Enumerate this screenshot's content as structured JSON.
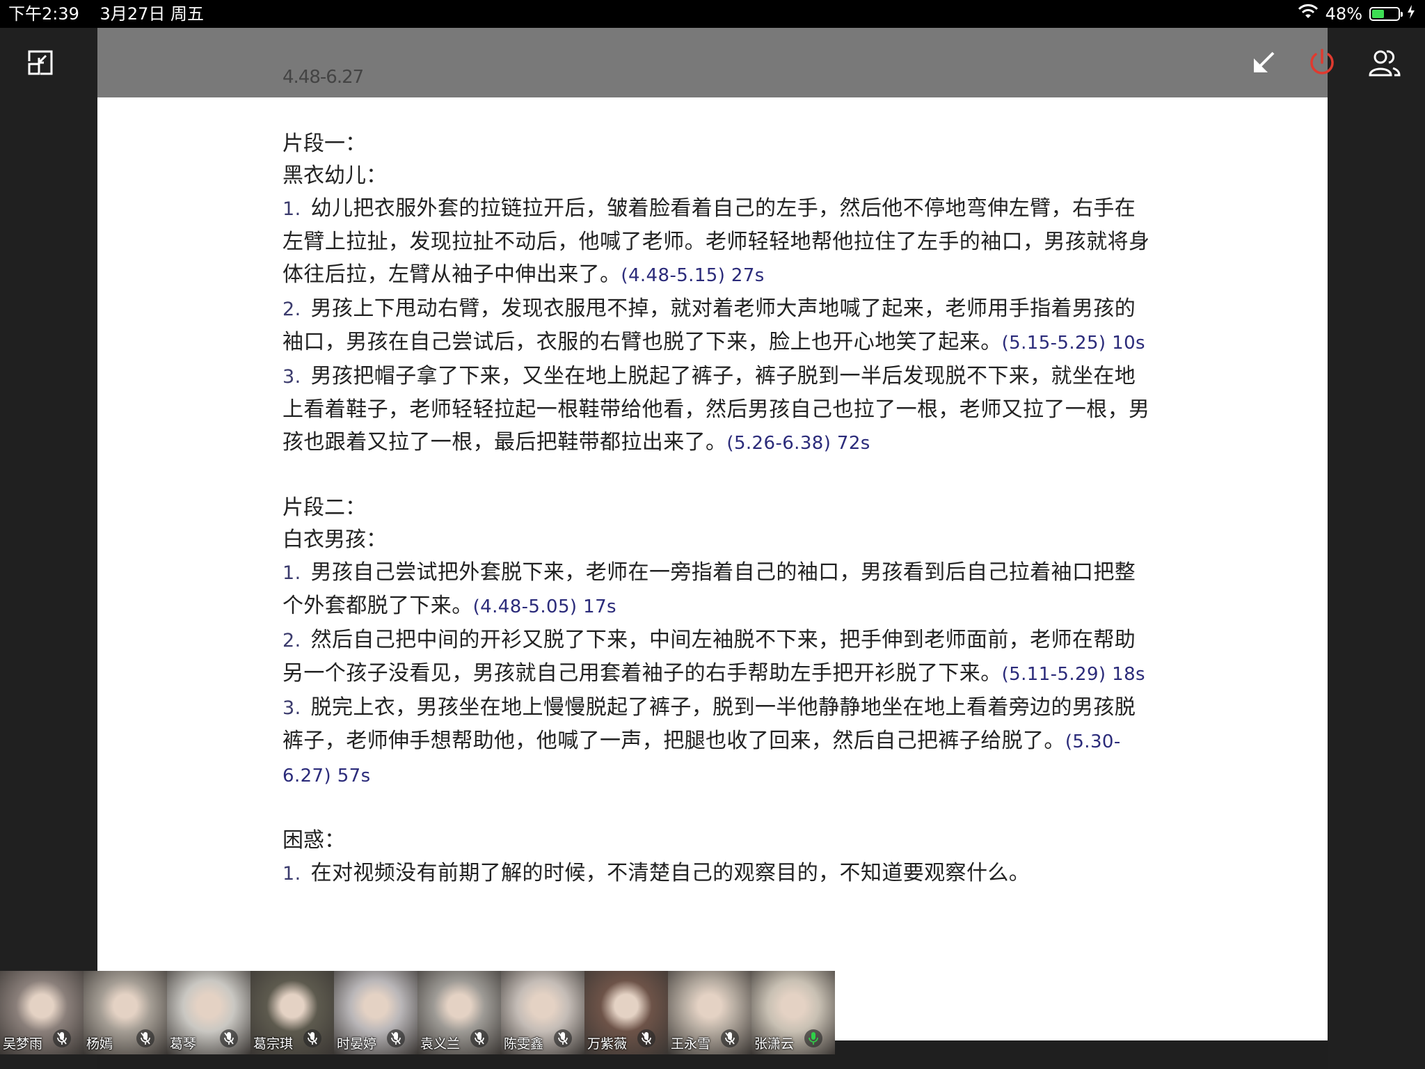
{
  "status_bar": {
    "time": "下午2:39",
    "date": "3月27日 周五",
    "battery": "48%",
    "battery_level": 0.48,
    "battery_color": "#3ddc53"
  },
  "document": {
    "version_line": "4.48-6.27",
    "fragment1_title": "片段一：",
    "fragment1_subject": "黑衣幼儿：",
    "fragment1_items": [
      {
        "num": "1.",
        "text": "幼儿把衣服外套的拉链拉开后，皱着脸看着自己的左手，然后他不停地弯伸左臂，右手在左臂上拉扯，发现拉扯不动后，他喊了老师。老师轻轻地帮他拉住了左手的袖口，男孩就将身体往后拉，左臂从袖子中伸出来了。",
        "ts": "(4.48-5.15) 27s"
      },
      {
        "num": "2.",
        "text": "男孩上下甩动右臂，发现衣服甩不掉，就对着老师大声地喊了起来，老师用手指着男孩的袖口，男孩在自己尝试后，衣服的右臂也脱了下来，脸上也开心地笑了起来。",
        "ts": "(5.15-5.25) 10s"
      },
      {
        "num": "3.",
        "text": "男孩把帽子拿了下来，又坐在地上脱起了裤子，裤子脱到一半后发现脱不下来，就坐在地上看着鞋子，老师轻轻拉起一根鞋带给他看，然后男孩自己也拉了一根，老师又拉了一根，男孩也跟着又拉了一根，最后把鞋带都拉出来了。",
        "ts": "(5.26-6.38) 72s"
      }
    ],
    "fragment2_title": "片段二：",
    "fragment2_subject": "白衣男孩：",
    "fragment2_items": [
      {
        "num": "1.",
        "text": "男孩自己尝试把外套脱下来，老师在一旁指着自己的袖口，男孩看到后自己拉着袖口把整个外套都脱了下来。",
        "ts": "(4.48-5.05) 17s"
      },
      {
        "num": "2.",
        "text": "然后自己把中间的开衫又脱了下来，中间左袖脱不下来，把手伸到老师面前，老师在帮助另一个孩子没看见，男孩就自己用套着袖子的右手帮助左手把开衫脱了下来。",
        "ts": "(5.11-5.29) 18s"
      },
      {
        "num": "3.",
        "text": "脱完上衣，男孩坐在地上慢慢脱起了裤子，脱到一半他静静地坐在地上看着旁边的男孩脱裤子，老师伸手想帮助他，他喊了一声，把腿也收了回来，然后自己把裤子给脱了。",
        "ts": "(5.30-6.27) 57s"
      }
    ],
    "confusion_title": "困惑：",
    "confusion_items": [
      {
        "num": "1.",
        "text": "在对视频没有前期了解的时候，不清楚自己的观察目的，不知道要观察什么。"
      }
    ]
  },
  "participants": [
    {
      "name": "吴梦雨",
      "mic": "muted",
      "bg": "#8a7f7a"
    },
    {
      "name": "杨嫣",
      "mic": "muted",
      "bg": "#a49d94"
    },
    {
      "name": "葛琴",
      "mic": "muted",
      "bg": "#c9c7c2"
    },
    {
      "name": "葛宗琪",
      "mic": "muted",
      "bg": "#5d5a4e"
    },
    {
      "name": "时晏婷",
      "mic": "muted",
      "bg": "#b9b6b8"
    },
    {
      "name": "袁义兰",
      "mic": "muted",
      "bg": "#9d9a95"
    },
    {
      "name": "陈雯鑫",
      "mic": "muted",
      "bg": "#c4bcb6"
    },
    {
      "name": "万紫薇",
      "mic": "muted",
      "bg": "#6d5348"
    },
    {
      "name": "王永雪",
      "mic": "muted",
      "bg": "#b6aca1"
    },
    {
      "name": "张潇云",
      "mic": "active",
      "bg": "#c8c0b3"
    }
  ],
  "colors": {
    "leave_icon": "#e03a2f",
    "mic_active": "#2fcf48"
  }
}
